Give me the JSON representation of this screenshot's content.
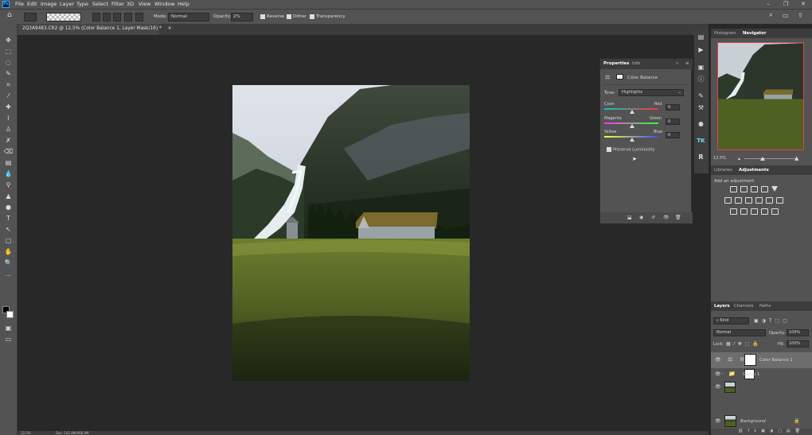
{
  "app": {
    "logo": "Ps"
  },
  "menu": [
    "File",
    "Edit",
    "Image",
    "Layer",
    "Type",
    "Select",
    "Filter",
    "3D",
    "View",
    "Window",
    "Help"
  ],
  "window_controls": [
    "–",
    "❐",
    "✕"
  ],
  "options_bar": {
    "mode_label": "Mode:",
    "mode_value": "Normal",
    "opacity_label": "Opacity:",
    "opacity_value": "2%",
    "reverse_label": "Reverse",
    "dither_label": "Dither",
    "transparency_label": "Transparency"
  },
  "document_tab": {
    "title": "2Q3A9483.CR2 @ 12,5% (Color Balance 1, Layer Mask/16) *",
    "close": "×"
  },
  "status_bar": {
    "zoom": "12,5%",
    "doc": "Doc: 142,4M/468,0M"
  },
  "properties": {
    "tabs": [
      "Properties",
      "Info"
    ],
    "title": "Color Balance",
    "tone_label": "Tone:",
    "tone_value": "Highlights",
    "sliders": [
      {
        "left": "Cyan",
        "right": "Red",
        "value": "0",
        "position": 0.5
      },
      {
        "left": "Magenta",
        "right": "Green",
        "value": "0",
        "position": 0.5
      },
      {
        "left": "Yellow",
        "right": "Blue",
        "value": "0",
        "position": 0.5
      }
    ],
    "preserve_luminosity": "Preserve Luminosity"
  },
  "navigator": {
    "tabs": [
      "Histogram",
      "Navigator"
    ],
    "zoom": "12,5%"
  },
  "adjustments": {
    "tabs": [
      "Libraries",
      "Adjustments"
    ],
    "add_label": "Add an adjustment"
  },
  "layers": {
    "tabs": [
      "Layers",
      "Channels",
      "Paths"
    ],
    "filter_kind": "Kind",
    "blend_mode": "Normal",
    "opacity_label": "Opacity:",
    "opacity_value": "100%",
    "lock_label": "Lock:",
    "fill_label": "Fill:",
    "fill_value": "100%",
    "items": [
      {
        "name": "Color Balance 1"
      },
      {
        "name": "Group 1"
      },
      {
        "name": "Background"
      }
    ]
  },
  "colors": {
    "accent": "#31a8ff",
    "panel": "#535353",
    "dark": "#3c3c3c",
    "canvas": "#282828",
    "navigator_frame": "#e0434b"
  }
}
